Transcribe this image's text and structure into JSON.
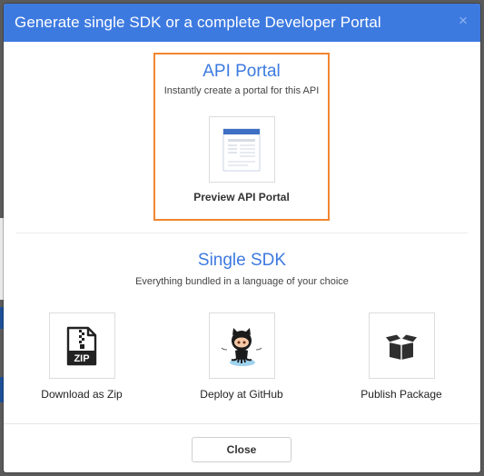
{
  "modal": {
    "title": "Generate single SDK or a complete Developer Portal",
    "close_glyph": "×"
  },
  "api_portal": {
    "title": "API Portal",
    "subtitle": "Instantly create a portal for this API",
    "preview_label": "Preview API Portal",
    "highlight_color": "#f2852f"
  },
  "single_sdk": {
    "title": "Single SDK",
    "subtitle": "Everything bundled in a language of your choice",
    "options": [
      {
        "label": "Download as Zip",
        "icon": "zip-file-icon",
        "icon_text": "ZIP"
      },
      {
        "label": "Deploy at GitHub",
        "icon": "github-octocat-icon"
      },
      {
        "label": "Publish Package",
        "icon": "package-box-icon"
      }
    ]
  },
  "footer": {
    "close_label": "Close"
  },
  "colors": {
    "header": "#3d7ae0",
    "accent_text": "#3d7ae0"
  }
}
